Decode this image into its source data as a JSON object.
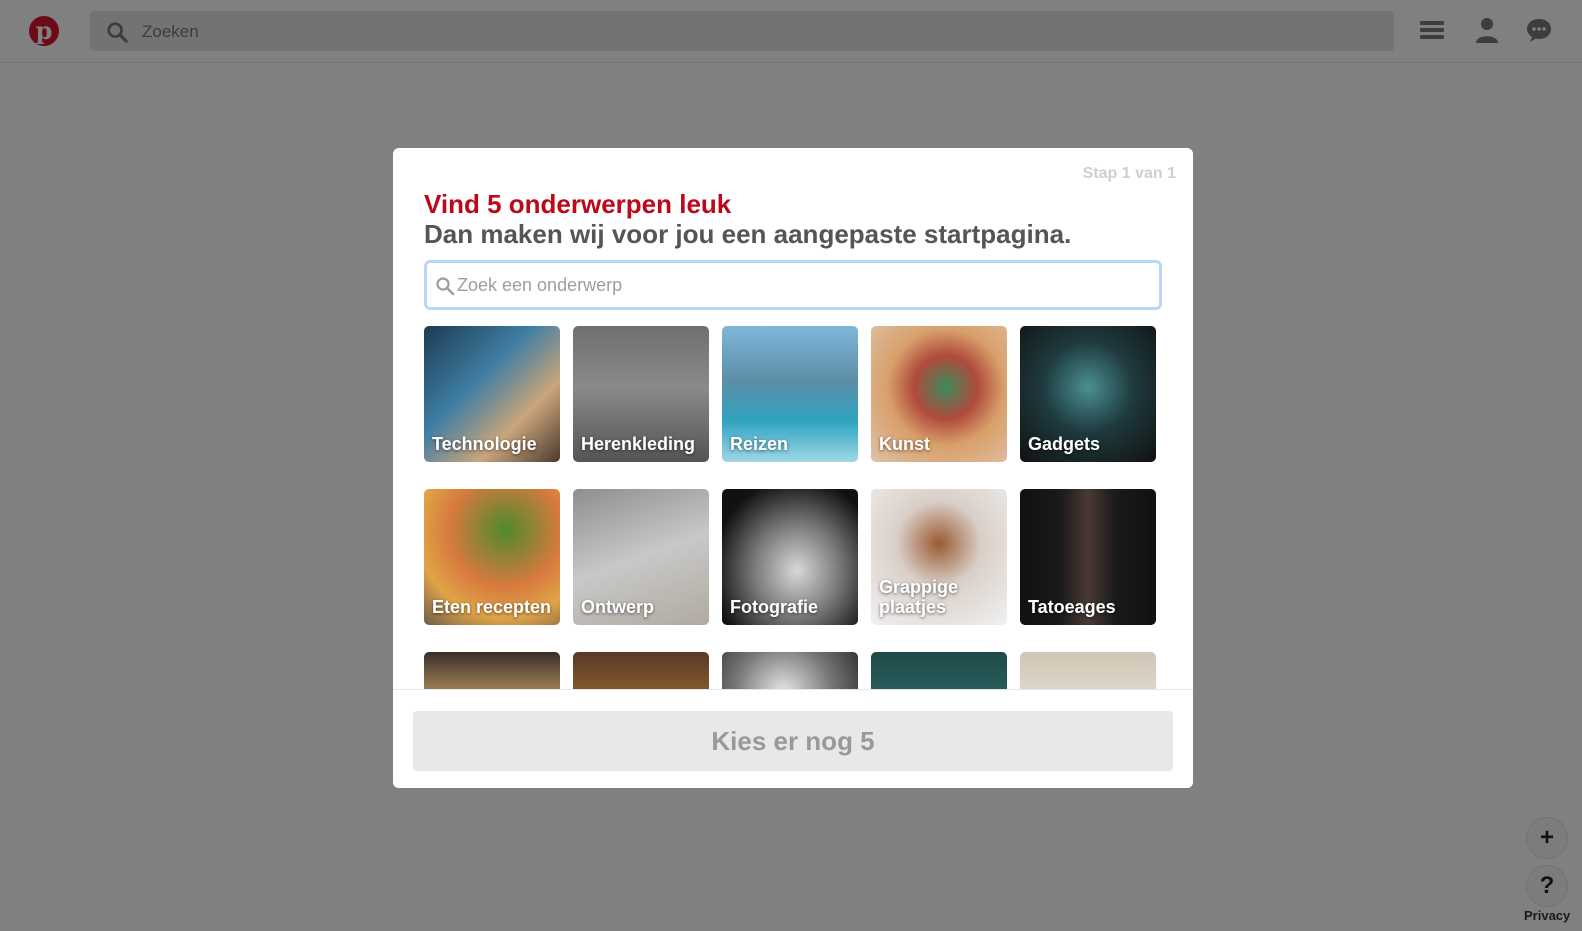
{
  "header": {
    "logo_glyph": "p",
    "search_placeholder": "Zoeken"
  },
  "modal": {
    "step_text": "Stap 1 van 1",
    "title_red": "Vind 5 onderwerpen leuk",
    "title_sub": "Dan maken wij voor jou een aangepaste startpagina.",
    "search_placeholder": "Zoek een onderwerp",
    "topics": [
      {
        "label": "Technologie"
      },
      {
        "label": "Herenkleding"
      },
      {
        "label": "Reizen"
      },
      {
        "label": "Kunst"
      },
      {
        "label": "Gadgets"
      },
      {
        "label": "Eten recepten"
      },
      {
        "label": "Ontwerp"
      },
      {
        "label": "Fotografie"
      },
      {
        "label": "Grappige plaatjes"
      },
      {
        "label": "Tatoeages"
      }
    ],
    "cta_label": "Kies er nog 5"
  },
  "side_buttons": {
    "plus_glyph": "+",
    "help_glyph": "?",
    "privacy_label": "Privacy"
  },
  "colors": {
    "brand_red": "#bd081c",
    "overlay_grey": "#808080"
  },
  "icons": [
    "search-icon",
    "menu-icon",
    "profile-icon",
    "messages-icon",
    "plus-icon",
    "help-icon"
  ]
}
